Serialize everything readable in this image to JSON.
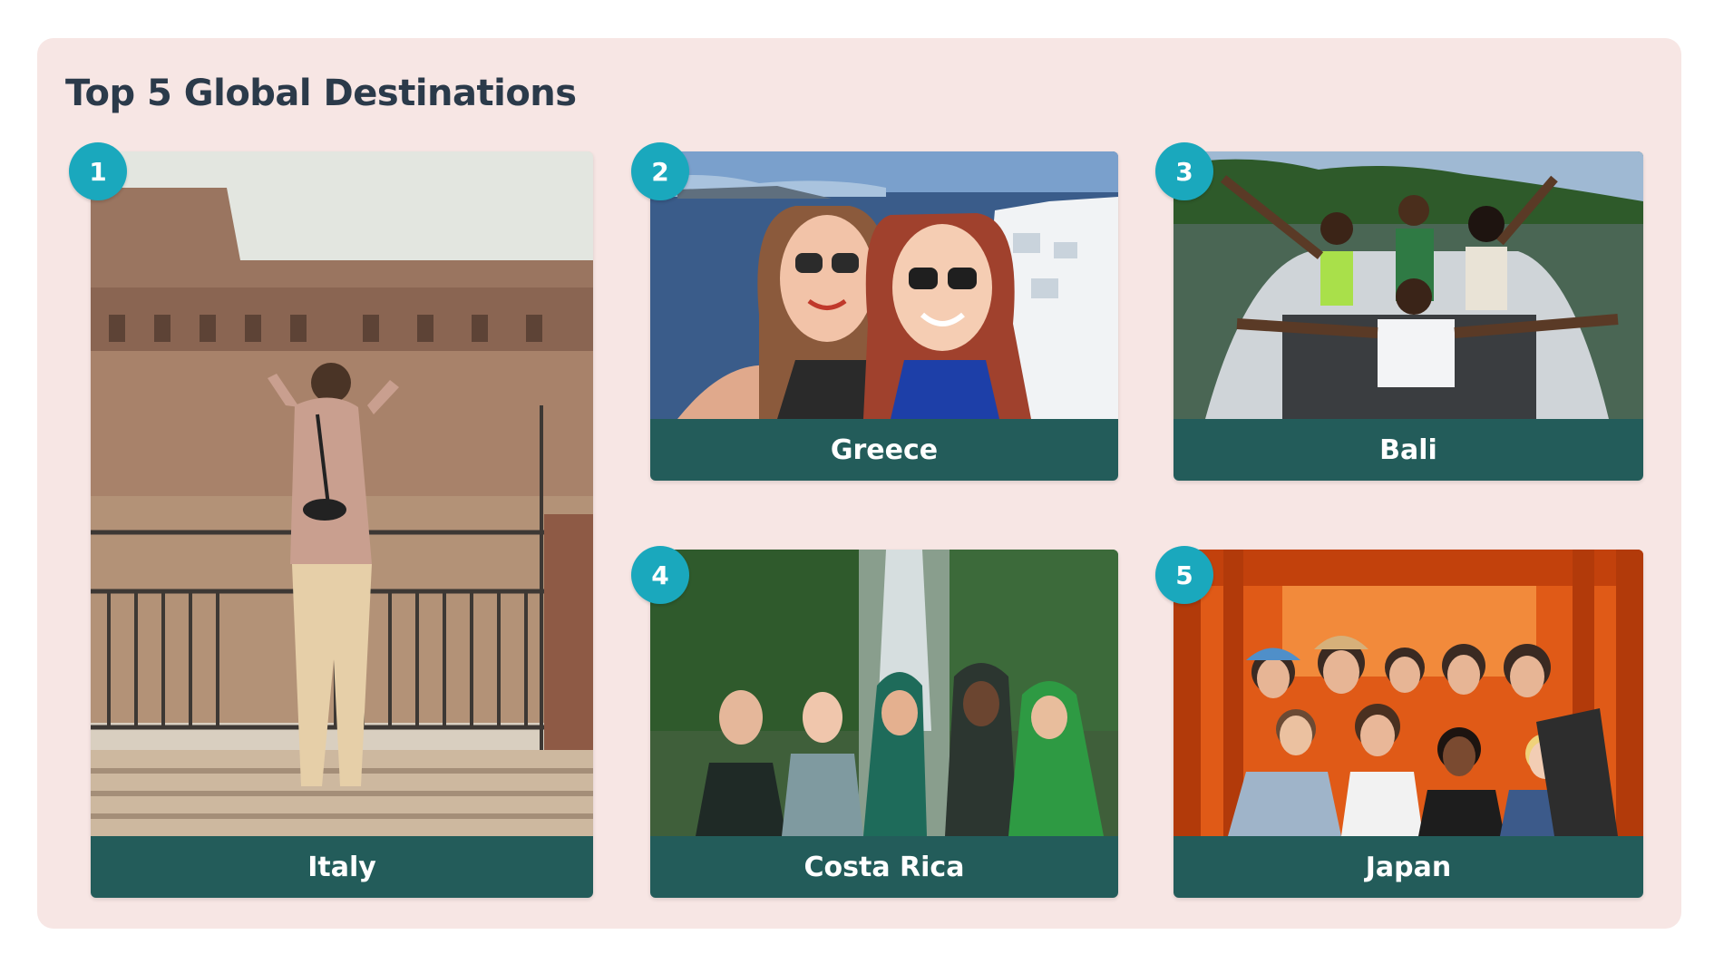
{
  "title": "Top 5 Global Destinations",
  "colors": {
    "panel_background": "#f7e6e4",
    "caption_background": "#235c5a",
    "badge": "#1aa8bd",
    "title_text": "#2b3a4a"
  },
  "destinations": [
    {
      "rank": "1",
      "name": "Italy",
      "photo": "colosseum-photo"
    },
    {
      "rank": "2",
      "name": "Greece",
      "photo": "santorini-selfie-photo"
    },
    {
      "rank": "3",
      "name": "Bali",
      "photo": "boat-group-photo"
    },
    {
      "rank": "4",
      "name": "Costa Rica",
      "photo": "waterfall-group-photo"
    },
    {
      "rank": "5",
      "name": "Japan",
      "photo": "torii-gates-group-photo"
    }
  ]
}
